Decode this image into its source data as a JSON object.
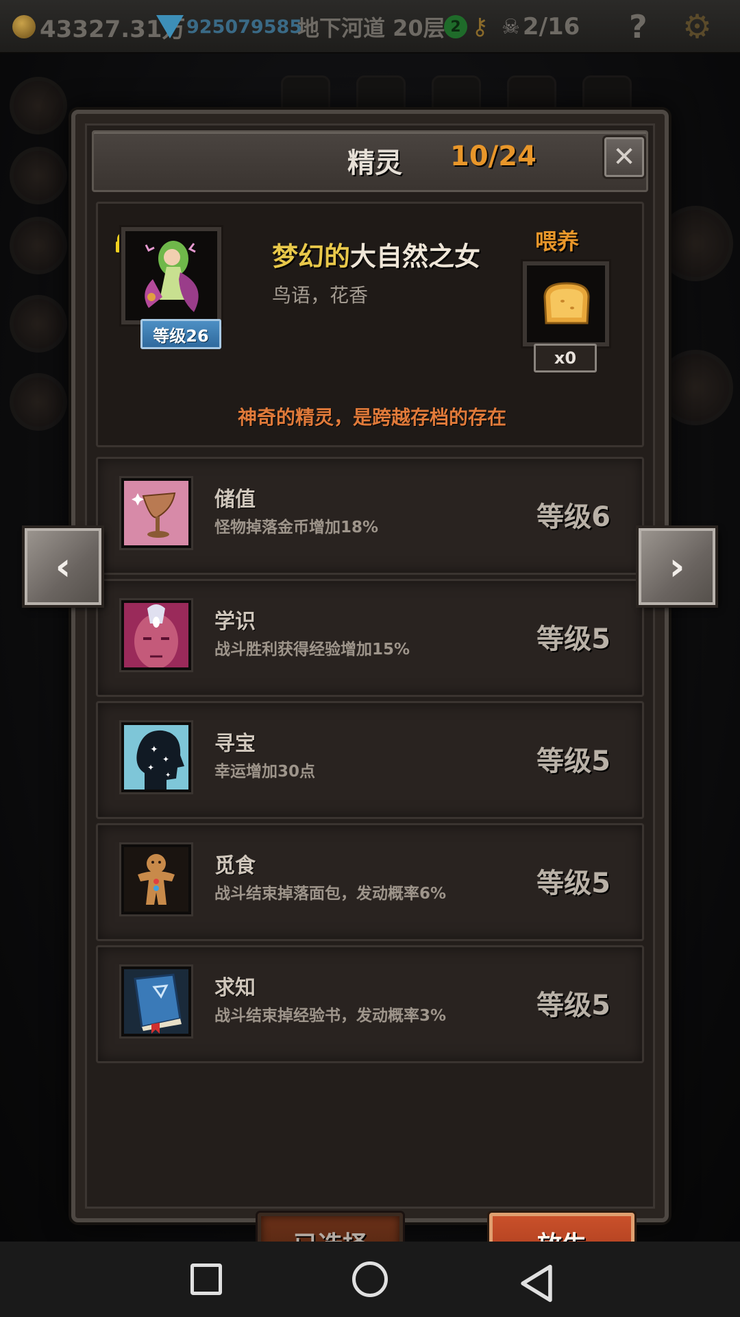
{
  "topbar": {
    "gold": "43327.31万",
    "diamonds": "925079585",
    "location": "地下河道 20层",
    "badge": "2",
    "skull_count": "2/16",
    "help": "?"
  },
  "modal": {
    "title": "精灵",
    "count": "10/24",
    "close": "✕"
  },
  "spirit": {
    "stars": "★★★★",
    "level": "等级26",
    "name_prefix": "梦幻的",
    "name_main": "大自然之女",
    "subtitle": "鸟语，花香",
    "feed_label": "喂养",
    "feed_count": "x0",
    "description": "神奇的精灵，是跨越存档的存在"
  },
  "skills": [
    {
      "name": "储值",
      "desc": "怪物掉落金币增加18%",
      "level": "等级6",
      "icon": "goblet-icon"
    },
    {
      "name": "学识",
      "desc": "战斗胜利获得经验增加15%",
      "level": "等级5",
      "icon": "third-eye-icon"
    },
    {
      "name": "寻宝",
      "desc": "幸运增加30点",
      "level": "等级5",
      "icon": "starry-head-icon"
    },
    {
      "name": "觅食",
      "desc": "战斗结束掉落面包，发动概率6%",
      "level": "等级5",
      "icon": "gingerbread-icon"
    },
    {
      "name": "求知",
      "desc": "战斗结束掉经验书，发动概率3%",
      "level": "等级5",
      "icon": "book-icon"
    }
  ],
  "nav": {
    "prev": "‹",
    "next": "›"
  },
  "buttons": {
    "selected": "已选择",
    "release": "放生"
  },
  "colors": {
    "accent_orange": "#e8962a",
    "name_gold": "#e8c84a",
    "description": "#e07a3a",
    "level_badge": "#3f7fb6",
    "release_button": "#b8441f"
  }
}
